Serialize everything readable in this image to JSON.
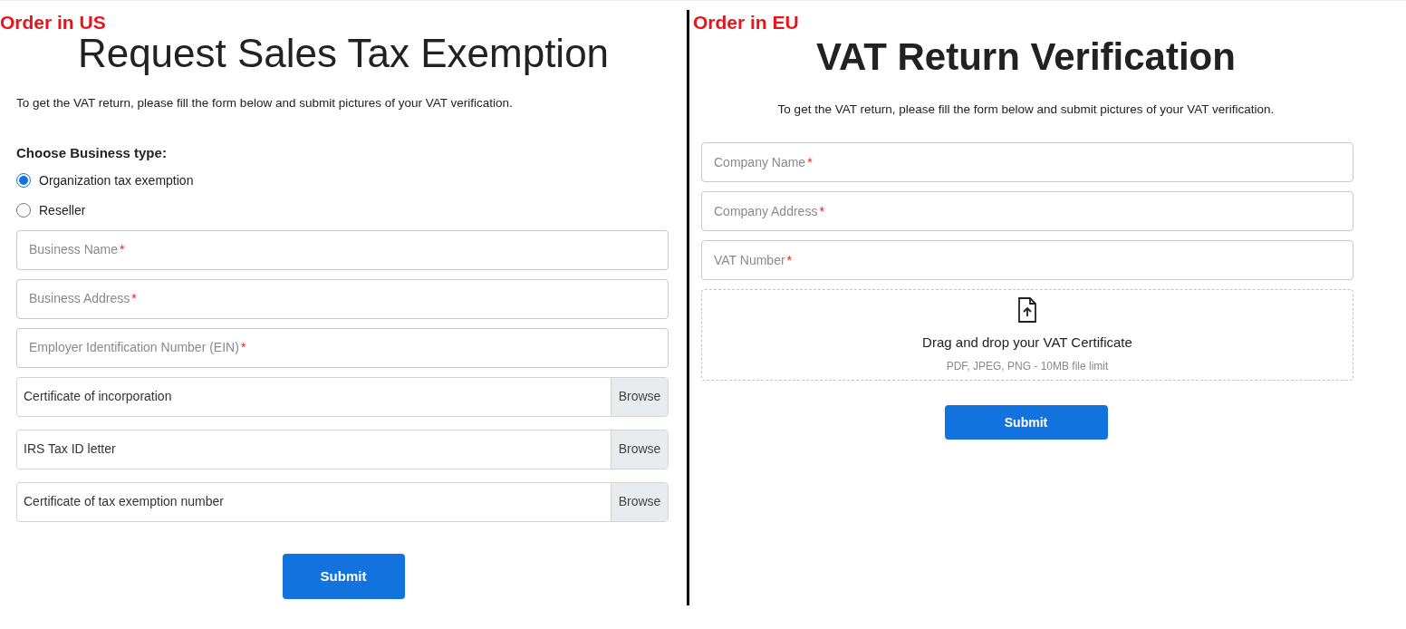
{
  "us": {
    "corner_label": "Order in US",
    "title": "Request Sales Tax Exemption",
    "intro": "To get the VAT return, please fill the form below and submit pictures of your VAT verification.",
    "business_type": {
      "label": "Choose Business type:",
      "options": [
        {
          "label": "Organization tax exemption",
          "selected": true
        },
        {
          "label": "Reseller",
          "selected": false
        }
      ]
    },
    "fields": [
      {
        "placeholder": "Business Name",
        "required_mark": "*"
      },
      {
        "placeholder": "Business Address",
        "required_mark": "*"
      },
      {
        "placeholder": "Employer Identification Number (EIN)",
        "required_mark": "*"
      }
    ],
    "file_fields": [
      {
        "label": "Certificate of incorporation",
        "button": "Browse"
      },
      {
        "label": "IRS Tax ID letter",
        "button": "Browse"
      },
      {
        "label": "Certificate of tax exemption number",
        "button": "Browse"
      }
    ],
    "submit": "Submit"
  },
  "eu": {
    "corner_label": "Order in EU",
    "title": "VAT Return Verification",
    "intro": "To get the VAT return, please fill the form below and submit pictures of your VAT verification.",
    "fields": [
      {
        "placeholder": "Company Name",
        "required_mark": "*"
      },
      {
        "placeholder": "Company Address",
        "required_mark": "*"
      },
      {
        "placeholder": "VAT Number",
        "required_mark": "*"
      }
    ],
    "dropzone": {
      "title": "Drag and drop your VAT Certificate",
      "hint": "PDF, JPEG, PNG - 10MB file limit"
    },
    "submit": "Submit"
  }
}
